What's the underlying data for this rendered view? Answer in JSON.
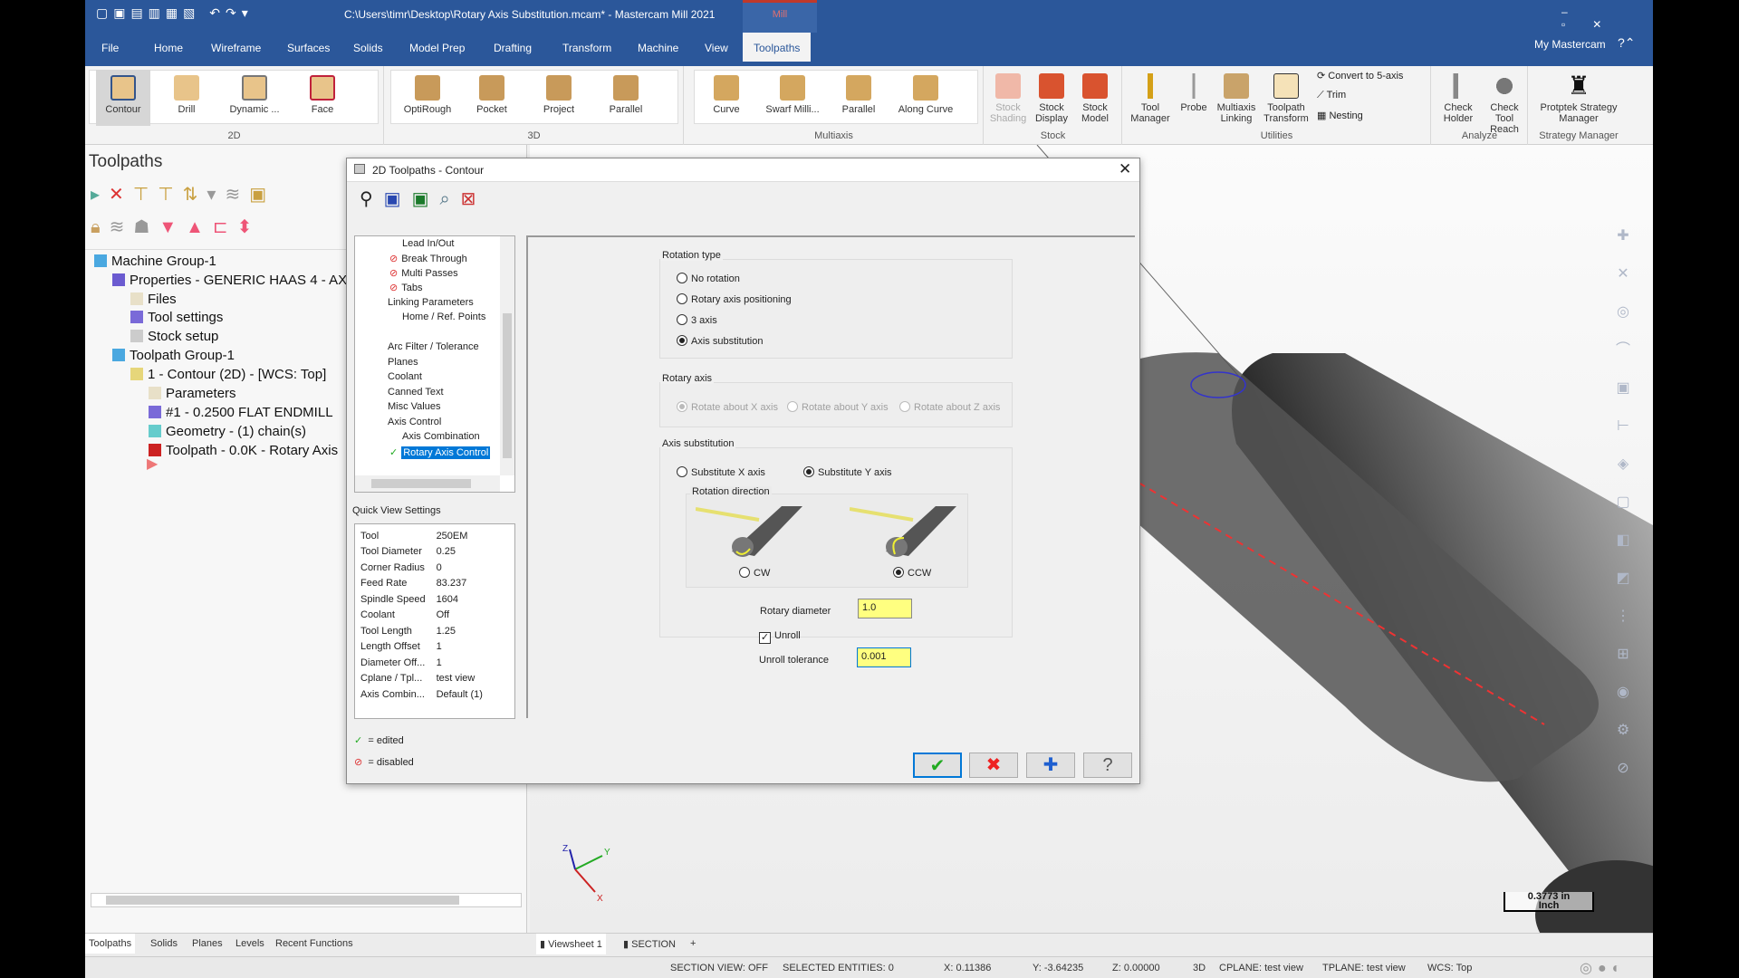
{
  "window": {
    "title": "C:\\Users\\timr\\Desktop\\Rotary Axis Substitution.mcam* - Mastercam Mill 2021",
    "context_tab": "Mill",
    "my_mastercam": "My Mastercam"
  },
  "menu": [
    "File",
    "Home",
    "Wireframe",
    "Surfaces",
    "Solids",
    "Model Prep",
    "Drafting",
    "Transform",
    "Machine",
    "View",
    "Toolpaths"
  ],
  "ribbon": {
    "groups": [
      "2D",
      "3D",
      "Multiaxis",
      "Stock",
      "Utilities",
      "Analyze",
      "Strategy Manager"
    ],
    "g2d": [
      "Contour",
      "Drill",
      "Dynamic ...",
      "Face"
    ],
    "g3d": [
      "OptiRough",
      "Pocket",
      "Project",
      "Parallel"
    ],
    "gmulti": [
      "Curve",
      "Swarf Milli...",
      "Parallel",
      "Along Curve"
    ],
    "gstock": [
      "Stock Shading",
      "Stock Display",
      "Stock Model"
    ],
    "gutil": [
      "Tool Manager",
      "Probe",
      "Multiaxis Linking",
      "Toolpath Transform"
    ],
    "gutil_small": [
      "Convert to 5-axis",
      "Trim",
      "Nesting"
    ],
    "ganalyze": [
      "Check Holder",
      "Check Tool Reach"
    ],
    "gstrategy": [
      "Protptek Strategy Manager"
    ]
  },
  "panel": {
    "title": "Toolpaths",
    "tree": [
      {
        "label": "Machine Group-1",
        "icon": "machine-group-icon"
      },
      {
        "label": "Properties - GENERIC HAAS 4 - AXIS",
        "icon": "properties-icon"
      },
      {
        "label": "Files",
        "icon": "folder-icon"
      },
      {
        "label": "Tool settings",
        "icon": "tool-icon"
      },
      {
        "label": "Stock setup",
        "icon": "stock-icon"
      },
      {
        "label": "Toolpath Group-1",
        "icon": "toolpath-group-icon"
      },
      {
        "label": "1 - Contour (2D) - [WCS: Top]",
        "icon": "open-folder-icon"
      },
      {
        "label": "Parameters",
        "icon": "folder-icon"
      },
      {
        "label": "#1 - 0.2500 FLAT ENDMILL",
        "icon": "tool-icon"
      },
      {
        "label": "Geometry - (1) chain(s)",
        "icon": "geometry-icon"
      },
      {
        "label": "Toolpath - 0.0K - Rotary Axis",
        "icon": "dirty-toolpath-icon"
      }
    ]
  },
  "bottom_tabs": [
    "Toolpaths",
    "Solids",
    "Planes",
    "Levels",
    "Recent Functions"
  ],
  "view_tabs": [
    "Viewsheet 1",
    "SECTION",
    "+"
  ],
  "scale_label": [
    "0.3773 in",
    "Inch"
  ],
  "status": {
    "section": "SECTION VIEW: OFF",
    "selected": "SELECTED ENTITIES: 0",
    "x": "X:  0.11386",
    "y": "Y:  -3.64235",
    "z": "Z:  0.00000",
    "mode": "3D",
    "cplane": "CPLANE: test view",
    "tplane": "TPLANE: test view",
    "wcs": "WCS: Top"
  },
  "dialog": {
    "title": "2D Toolpaths - Contour",
    "tree": [
      {
        "label": "Lead In/Out",
        "state": ""
      },
      {
        "label": "Break Through",
        "state": "disabled"
      },
      {
        "label": "Multi Passes",
        "state": "disabled"
      },
      {
        "label": "Tabs",
        "state": "disabled"
      },
      {
        "label": "Linking Parameters",
        "state": ""
      },
      {
        "label": "Home / Ref. Points",
        "state": ""
      },
      {
        "label": "Arc Filter / Tolerance",
        "state": ""
      },
      {
        "label": "Planes",
        "state": ""
      },
      {
        "label": "Coolant",
        "state": ""
      },
      {
        "label": "Canned Text",
        "state": ""
      },
      {
        "label": "Misc Values",
        "state": ""
      },
      {
        "label": "Axis Control",
        "state": ""
      },
      {
        "label": "Axis Combination",
        "state": ""
      },
      {
        "label": "Rotary Axis Control",
        "state": "edited"
      }
    ],
    "quick_view_title": "Quick View Settings",
    "quick_view": [
      [
        "Tool",
        "250EM"
      ],
      [
        "Tool Diameter",
        "0.25"
      ],
      [
        "Corner Radius",
        "0"
      ],
      [
        "Feed Rate",
        "83.237"
      ],
      [
        "Spindle Speed",
        "1604"
      ],
      [
        "Coolant",
        "Off"
      ],
      [
        "Tool Length",
        "1.25"
      ],
      [
        "Length Offset",
        "1"
      ],
      [
        "Diameter Off...",
        "1"
      ],
      [
        "Cplane / Tpl...",
        "test view"
      ],
      [
        "Axis Combin...",
        "Default (1)"
      ]
    ],
    "legend": {
      "edited": "= edited",
      "disabled": "= disabled"
    },
    "rotation_type": {
      "label": "Rotation type",
      "options": [
        "No rotation",
        "Rotary axis positioning",
        "3 axis",
        "Axis substitution"
      ],
      "selected": "Axis substitution"
    },
    "rotary_axis": {
      "label": "Rotary axis",
      "options": [
        "Rotate about X axis",
        "Rotate about Y axis",
        "Rotate about Z axis"
      ],
      "selected": "Rotate about X axis",
      "disabled": true
    },
    "axis_substitution": {
      "label": "Axis substitution",
      "options": [
        "Substitute X axis",
        "Substitute Y axis"
      ],
      "selected": "Substitute Y axis"
    },
    "rotation_direction": {
      "label": "Rotation direction",
      "options": [
        "CW",
        "CCW"
      ],
      "selected": "CCW"
    },
    "rotary_diameter": {
      "label": "Rotary diameter",
      "value": "1.0"
    },
    "unroll": {
      "label": "Unroll",
      "checked": true
    },
    "unroll_tolerance": {
      "label": "Unroll tolerance",
      "value": "0.001"
    }
  },
  "colors": {
    "brand": "#2b579a",
    "field": "#ffff80",
    "selection": "#0078d7"
  }
}
